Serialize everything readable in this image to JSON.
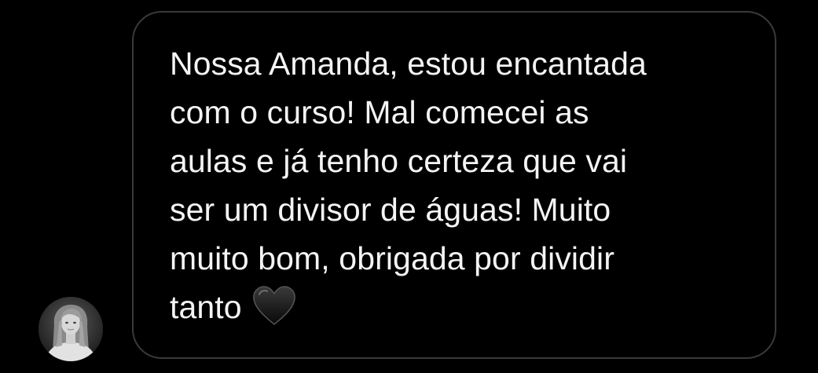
{
  "message": {
    "lines": [
      "Nossa Amanda, estou encantada",
      "com o curso! Mal comecei as",
      "aulas e já tenho certeza que vai",
      "ser um divisor de águas! Muito",
      "muito bom, obrigada por dividir",
      "tanto"
    ],
    "trailing_icon": "black-heart-icon"
  },
  "colors": {
    "background": "#000000",
    "bubble_border": "#3a3a3a",
    "text": "#f4f4f4"
  }
}
